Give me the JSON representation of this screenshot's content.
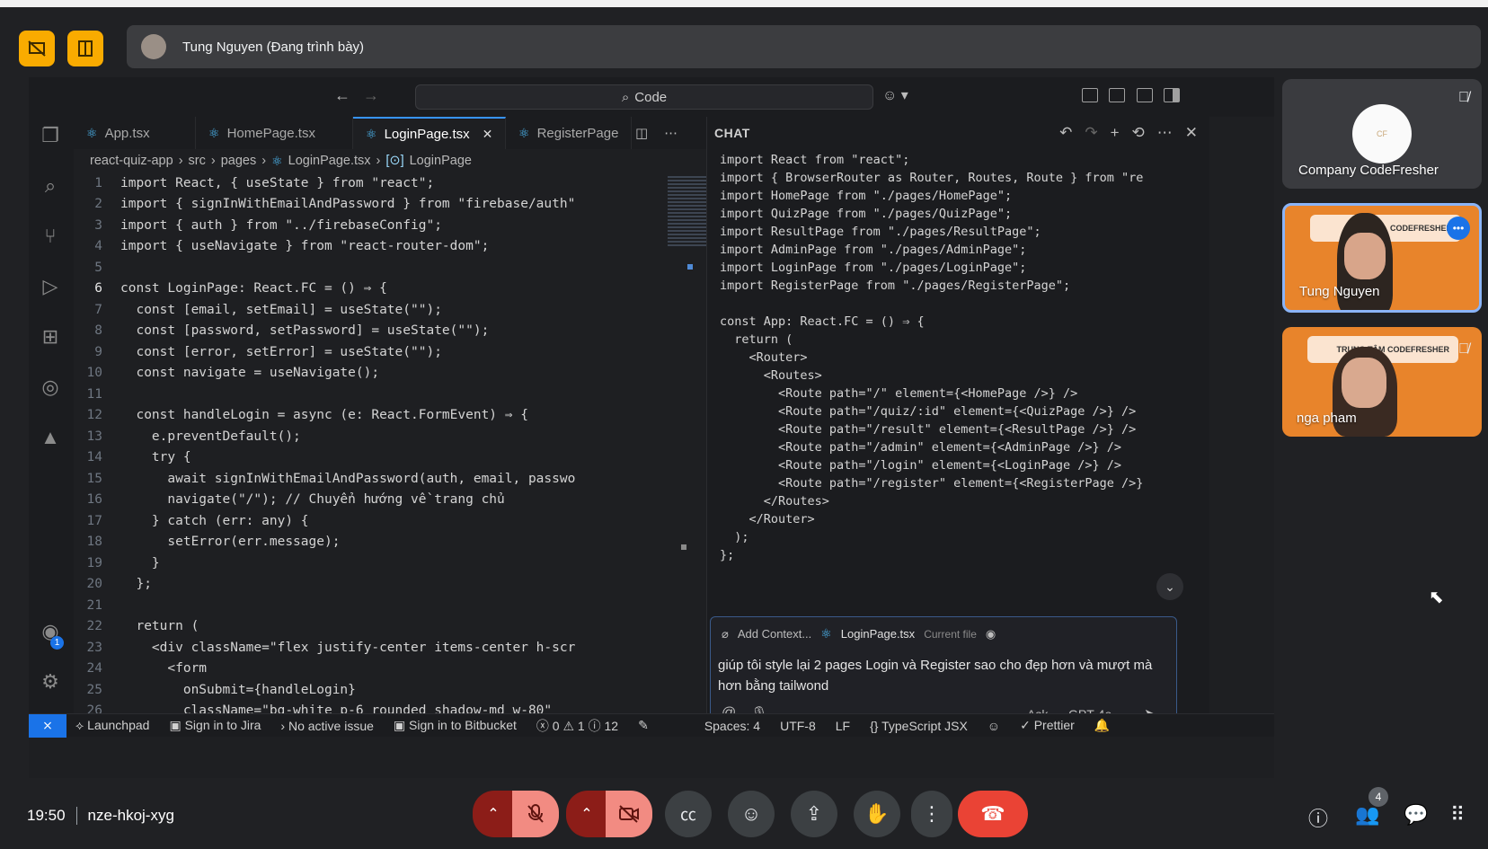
{
  "meet": {
    "presenter_label": "Tung Nguyen (Đang trình bày)",
    "meeting_time": "19:50",
    "meeting_code": "nze-hkoj-xyg",
    "participant_count": "4",
    "participants": [
      {
        "name": "Company CodeFresher",
        "muted": true
      },
      {
        "name": "Tung Nguyen",
        "speaking": true
      },
      {
        "name": "nga pham",
        "muted": true
      }
    ],
    "banner_text_1": "CODEFRESHER",
    "banner_text_2": "TRUNG TÂM CODEFRESHER"
  },
  "vscode": {
    "command_center": "Code",
    "tabs": [
      {
        "label": "App.tsx",
        "active": false
      },
      {
        "label": "HomePage.tsx",
        "active": false
      },
      {
        "label": "LoginPage.tsx",
        "active": true
      },
      {
        "label": "RegisterPage",
        "active": false
      }
    ],
    "breadcrumb": [
      "react-quiz-app",
      "src",
      "pages",
      "LoginPage.tsx",
      "LoginPage"
    ],
    "code_lines": [
      {
        "n": "1",
        "text": "import React, { useState } from \"react\";"
      },
      {
        "n": "2",
        "text": "import { signInWithEmailAndPassword } from \"firebase/auth\""
      },
      {
        "n": "3",
        "text": "import { auth } from \"../firebaseConfig\";"
      },
      {
        "n": "4",
        "text": "import { useNavigate } from \"react-router-dom\";"
      },
      {
        "n": "5",
        "text": ""
      },
      {
        "n": "6",
        "text": "const LoginPage: React.FC = () ⇒ {"
      },
      {
        "n": "7",
        "text": "  const [email, setEmail] = useState(\"\");"
      },
      {
        "n": "8",
        "text": "  const [password, setPassword] = useState(\"\");"
      },
      {
        "n": "9",
        "text": "  const [error, setError] = useState(\"\");"
      },
      {
        "n": "10",
        "text": "  const navigate = useNavigate();"
      },
      {
        "n": "11",
        "text": ""
      },
      {
        "n": "12",
        "text": "  const handleLogin = async (e: React.FormEvent) ⇒ {"
      },
      {
        "n": "13",
        "text": "    e.preventDefault();"
      },
      {
        "n": "14",
        "text": "    try {"
      },
      {
        "n": "15",
        "text": "      await signInWithEmailAndPassword(auth, email, passwo"
      },
      {
        "n": "16",
        "text": "      navigate(\"/\"); // Chuyển hướng về trang chủ"
      },
      {
        "n": "17",
        "text": "    } catch (err: any) {"
      },
      {
        "n": "18",
        "text": "      setError(err.message);"
      },
      {
        "n": "19",
        "text": "    }"
      },
      {
        "n": "20",
        "text": "  };"
      },
      {
        "n": "21",
        "text": ""
      },
      {
        "n": "22",
        "text": "  return ("
      },
      {
        "n": "23",
        "text": "    <div className=\"flex justify-center items-center h-scr"
      },
      {
        "n": "24",
        "text": "      <form"
      },
      {
        "n": "25",
        "text": "        onSubmit={handleLogin}"
      },
      {
        "n": "26",
        "text": "        className=\"bg-white p-6 rounded shadow-md w-80\""
      }
    ],
    "chat": {
      "title": "CHAT",
      "code_lines": [
        "import React from \"react\";",
        "import { BrowserRouter as Router, Routes, Route } from \"re",
        "import HomePage from \"./pages/HomePage\";",
        "import QuizPage from \"./pages/QuizPage\";",
        "import ResultPage from \"./pages/ResultPage\";",
        "import AdminPage from \"./pages/AdminPage\";",
        "import LoginPage from \"./pages/LoginPage\";",
        "import RegisterPage from \"./pages/RegisterPage\";",
        "",
        "const App: React.FC = () ⇒ {",
        "  return (",
        "    <Router>",
        "      <Routes>",
        "        <Route path=\"/\" element={<HomePage />} />",
        "        <Route path=\"/quiz/:id\" element={<QuizPage />} />",
        "        <Route path=\"/result\" element={<ResultPage />} />",
        "        <Route path=\"/admin\" element={<AdminPage />} />",
        "        <Route path=\"/login\" element={<LoginPage />} />",
        "        <Route path=\"/register\" element={<RegisterPage />}",
        "      </Routes>",
        "    </Router>",
        "  );",
        "};"
      ],
      "add_context": "Add Context...",
      "context_file": "LoginPage.tsx",
      "context_note": "Current file",
      "prompt": "giúp tôi style lại 2 pages Login và Register sao cho đẹp hơn và mượt mà hơn bằng tailwond",
      "mode": "Ask",
      "model": "GPT-4o"
    },
    "status": {
      "launchpad": "Launchpad",
      "jira": "Sign in to Jira",
      "issue": "No active issue",
      "bitbucket": "Sign in to Bitbucket",
      "errors": "0",
      "warnings": "1",
      "info": "12",
      "spaces": "Spaces: 4",
      "encoding": "UTF-8",
      "eol": "LF",
      "language": "TypeScript JSX",
      "prettier": "Prettier"
    },
    "accounts_badge": "1"
  },
  "colors": {
    "accent": "#1a73e8",
    "end_call": "#ea4335",
    "warning_yellow": "#f9ab00",
    "tile_orange": "#e8842b"
  }
}
